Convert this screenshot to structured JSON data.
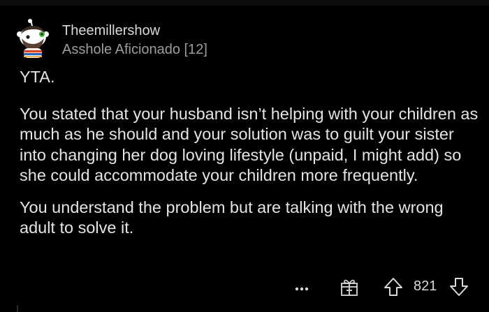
{
  "comment": {
    "author": {
      "username": "Theemillershow",
      "flair": "Asshole Aficionado [12]",
      "avatar_icon": "snoo-avatar-icon"
    },
    "body": {
      "paragraphs": [
        "YTA.",
        "You stated that your husband isn’t helping with your children as much as he should and your solution was to guilt your sister into changing her dog loving lifestyle (unpaid, I might add) so she could accommodate your children more frequently.",
        "You understand the problem but are talking with the wrong adult to solve it."
      ]
    },
    "actions": {
      "more_icon": "more-dots-icon",
      "award_icon": "award-gift-icon",
      "upvote_icon": "upvote-arrow-icon",
      "vote_count": "821",
      "downvote_icon": "downvote-arrow-icon"
    }
  },
  "colors": {
    "background": "#000000",
    "text_primary": "#d7dadc",
    "text_secondary": "#9a9c9e"
  }
}
